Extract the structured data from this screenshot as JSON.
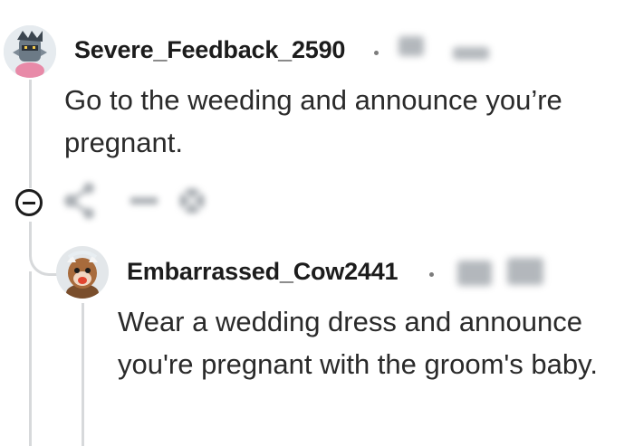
{
  "comments": [
    {
      "username": "Severe_Feedback_2590",
      "body": "Go to the weeding and announce you’re pregnant.",
      "avatar_icon": "knight-avatar-icon"
    },
    {
      "username": "Embarrassed_Cow2441",
      "body": "Wear a wedding dress and announce you're pregnant with the groom's baby.",
      "avatar_icon": "cow-avatar-icon"
    }
  ],
  "actions": {
    "collapse_icon": "collapse-icon",
    "share_icon": "share-icon",
    "award_icon": "award-icon"
  },
  "colors": {
    "thread_line": "#d7d9db",
    "text": "#1c1c1c",
    "meta": "#7c7c7c"
  }
}
